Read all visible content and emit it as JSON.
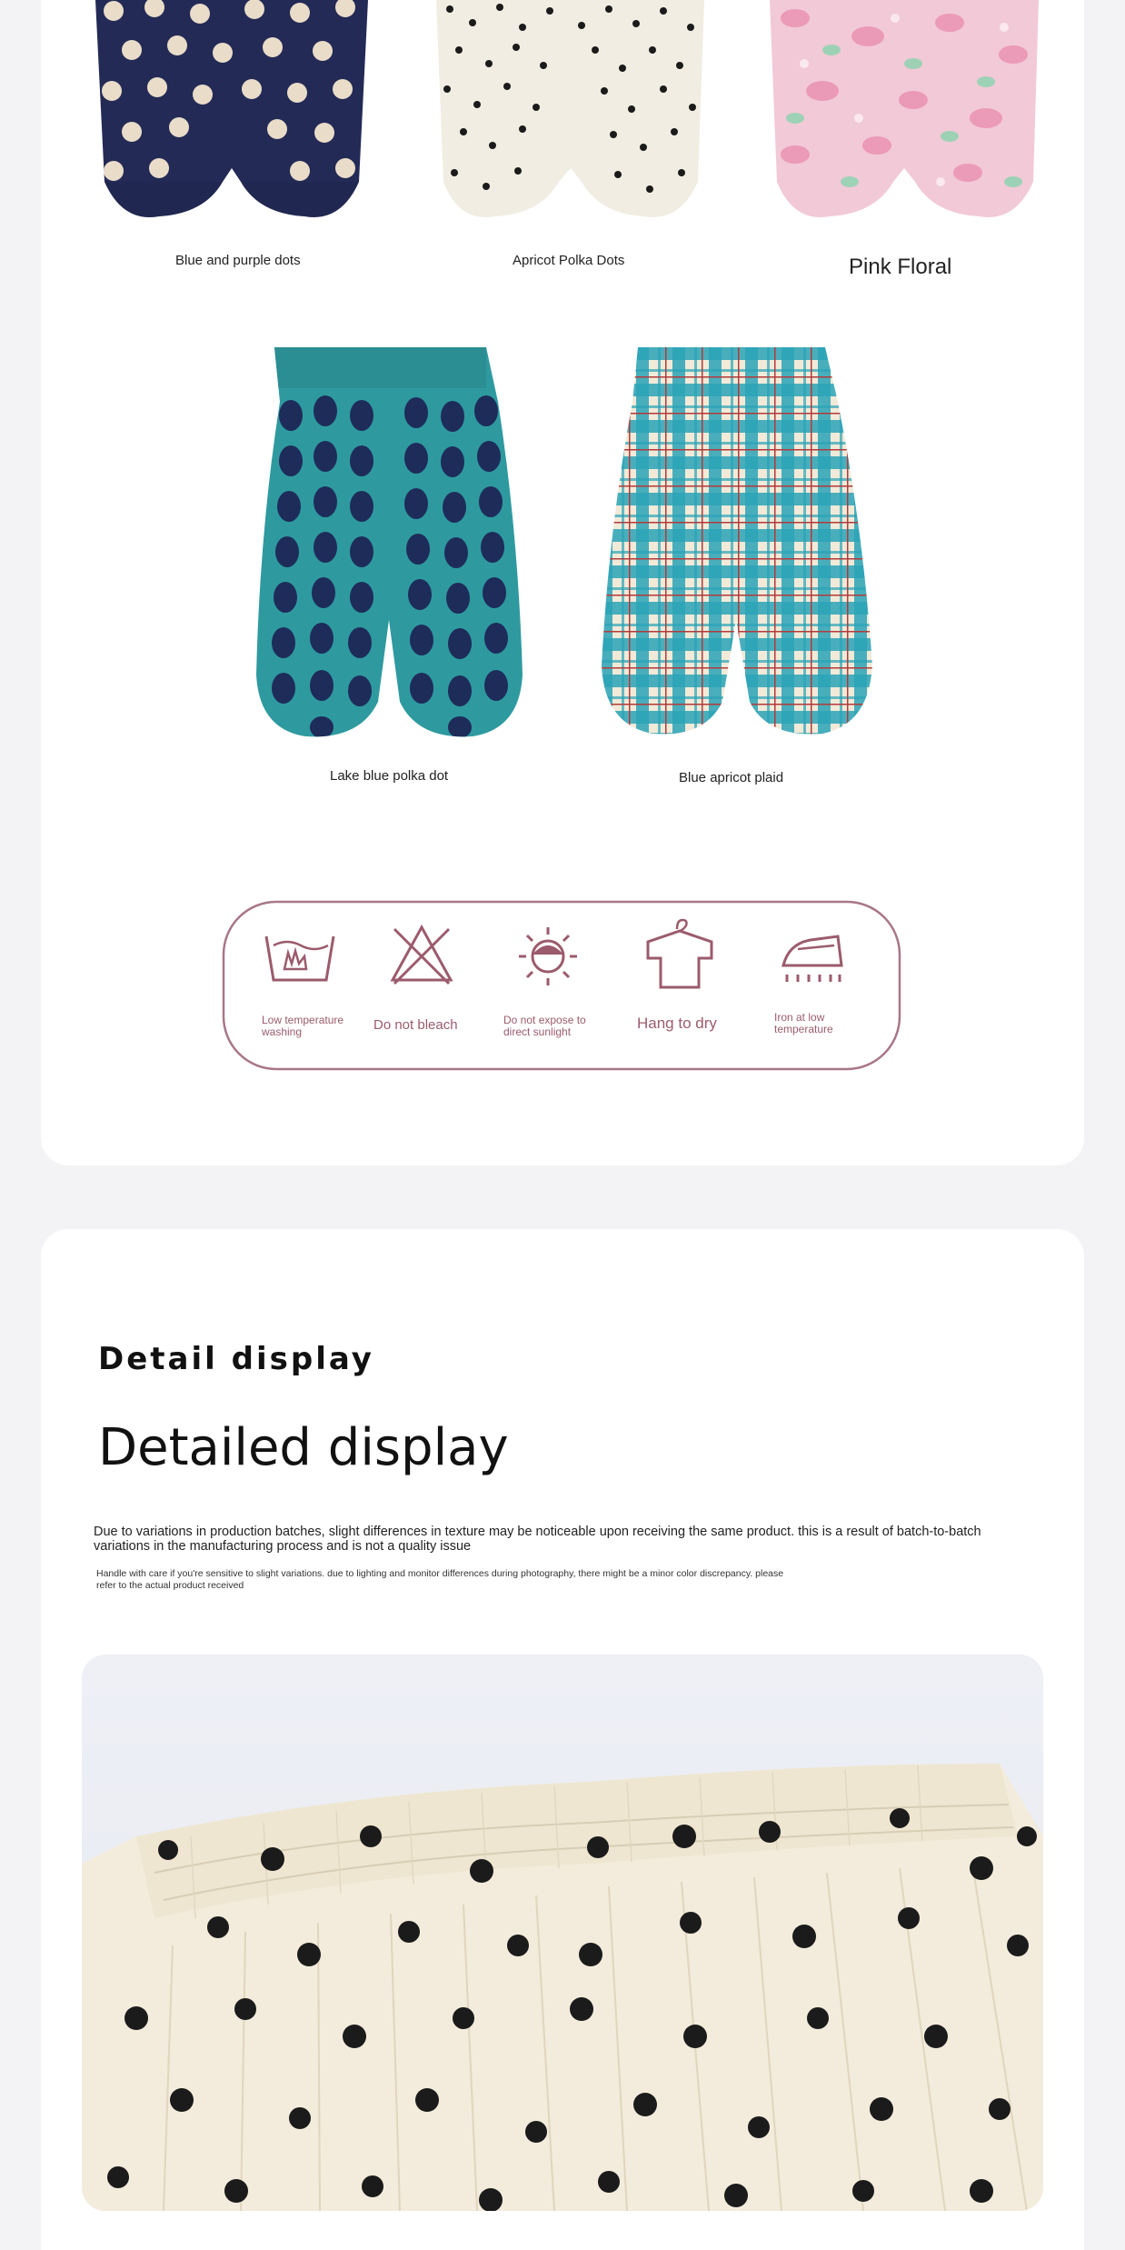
{
  "products_row1": [
    {
      "label": "Blue and purple dots",
      "colors": {
        "base": "#232a55",
        "dot": "#e9dcc9"
      }
    },
    {
      "label": "Apricot Polka Dots",
      "colors": {
        "base": "#f1ede2",
        "dot": "#1b1b1b"
      }
    },
    {
      "label": "Pink Floral",
      "colors": {
        "base": "#f2c9d6",
        "accent": "#8fd3b0"
      }
    }
  ],
  "products_row2": [
    {
      "label": "Lake blue polka dot",
      "colors": {
        "base": "#2e9a9f",
        "dot": "#1e2c5a"
      }
    },
    {
      "label": "Blue apricot plaid",
      "colors": {
        "base": "#f1ead8",
        "line": "#2aa3b8",
        "stripe": "#b33a3a"
      }
    }
  ],
  "care": {
    "accent_color": "#9b5b6c",
    "items": [
      {
        "icon": "low-temp-wash-icon",
        "label": "Low temperature washing"
      },
      {
        "icon": "no-bleach-icon",
        "label": "Do not bleach"
      },
      {
        "icon": "no-sunlight-icon",
        "label": "Do not expose to direct sunlight"
      },
      {
        "icon": "hang-dry-icon",
        "label": "Hang to dry"
      },
      {
        "icon": "low-iron-icon",
        "label": "Iron at low temperature"
      }
    ]
  },
  "detail": {
    "title_small": "Detail display",
    "title_big": "Detailed display",
    "note_main": "Due to variations in production batches, slight differences in texture may be noticeable upon receiving the same product. this is a result of batch-to-batch variations in the manufacturing process and is not a quality issue",
    "note_small": "Handle with care if you're sensitive to slight variations. due to lighting and monitor differences during photography, there might be a minor color discrepancy. please refer to the actual product received"
  }
}
